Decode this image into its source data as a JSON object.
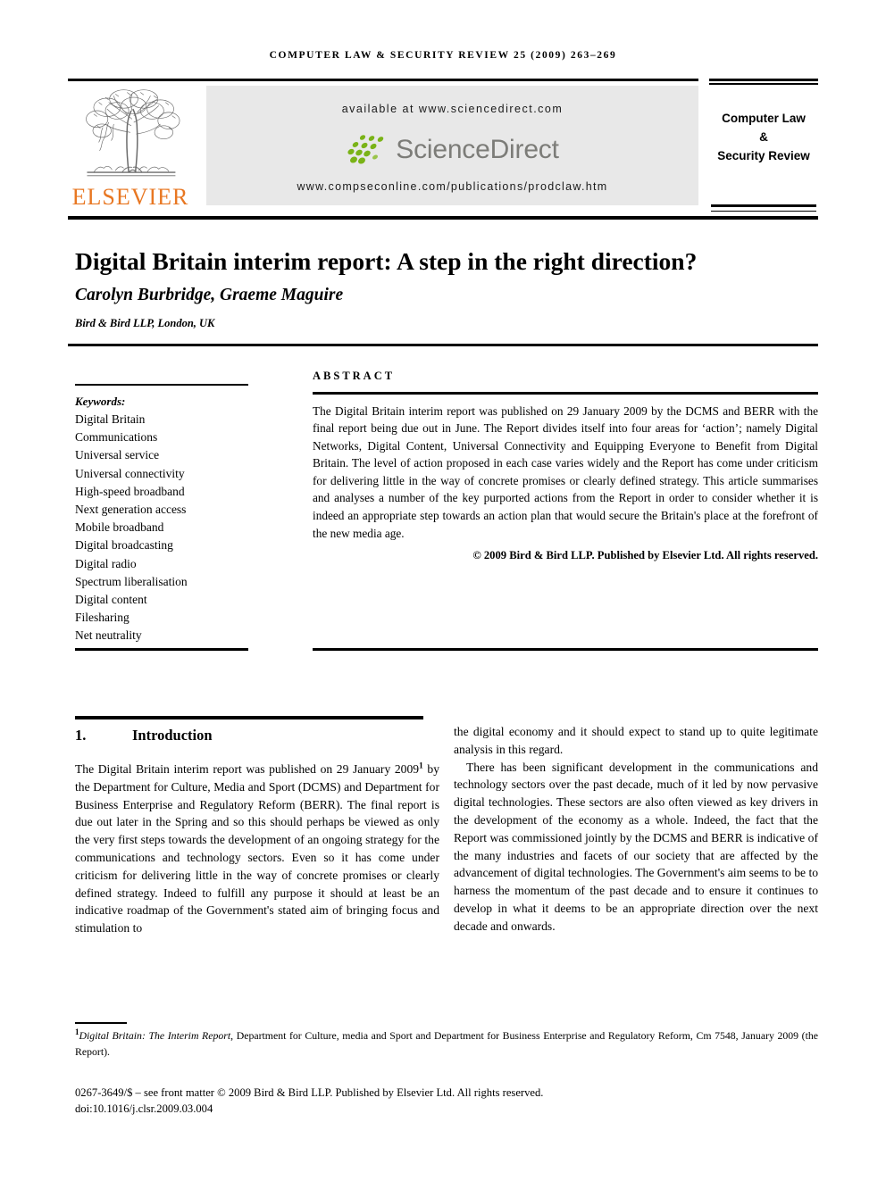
{
  "running_head": "COMPUTER LAW & SECURITY REVIEW 25 (2009) 263–269",
  "masthead": {
    "publisher_name": "ELSEVIER",
    "available_at": "available at www.sciencedirect.com",
    "sciencedirect_wordmark": "ScienceDirect",
    "journal_url": "www.compseconline.com/publications/prodclaw.htm",
    "journal_box_line1": "Computer Law",
    "journal_box_line2": "&",
    "journal_box_line3": "Security Review",
    "colors": {
      "elsevier_orange": "#E87722",
      "sciencedirect_green": "#7AB317",
      "sciencedirect_gray": "#7c7c78",
      "banner_background": "#e8e8e8"
    }
  },
  "article": {
    "title": "Digital Britain interim report: A step in the right direction?",
    "authors": "Carolyn Burbridge, Graeme Maguire",
    "affiliation": "Bird & Bird LLP, London, UK"
  },
  "keywords": {
    "label": "Keywords:",
    "items": [
      "Digital Britain",
      "Communications",
      "Universal service",
      "Universal connectivity",
      "High-speed broadband",
      "Next generation access",
      "Mobile broadband",
      "Digital broadcasting",
      "Digital radio",
      "Spectrum liberalisation",
      "Digital content",
      "Filesharing",
      "Net neutrality"
    ]
  },
  "abstract": {
    "heading": "ABSTRACT",
    "body": "The Digital Britain interim report was published on 29 January 2009 by the DCMS and BERR with the final report being due out in June. The Report divides itself into four areas for ‘action’; namely Digital Networks, Digital Content, Universal Connectivity and Equipping Everyone to Benefit from Digital Britain. The level of action proposed in each case varies widely and the Report has come under criticism for delivering little in the way of concrete promises or clearly defined strategy. This article summarises and analyses a number of the key purported actions from the Report in order to consider whether it is indeed an appropriate step towards an action plan that would secure the Britain's place at the forefront of the new media age.",
    "copyright": "© 2009 Bird & Bird LLP. Published by Elsevier Ltd. All rights reserved."
  },
  "section": {
    "number": "1.",
    "title": "Introduction",
    "left_paragraph_part1": "The Digital Britain interim report was published on 29 January 2009",
    "footnote_marker": "1",
    "left_paragraph_part2": " by the Department for Culture, Media and Sport (DCMS) and Department for Business Enterprise and Regulatory Reform (BERR). The final report is due out later in the Spring and so this should perhaps be viewed as only the very first steps towards the development of an ongoing strategy for the communications and technology sectors. Even so it has come under criticism for delivering little in the way of concrete promises or clearly defined strategy. Indeed to fulfill any purpose it should at least be an indicative roadmap of the Government's stated aim of bringing focus and stimulation to",
    "right_paragraph_1": "the digital economy and it should expect to stand up to quite legitimate analysis in this regard.",
    "right_paragraph_2": "There has been significant development in the communications and technology sectors over the past decade, much of it led by now pervasive digital technologies. These sectors are also often viewed as key drivers in the development of the economy as a whole. Indeed, the fact that the Report was commissioned jointly by the DCMS and BERR is indicative of the many industries and facets of our society that are affected by the advancement of digital technologies. The Government's aim seems to be to harness the momentum of the past decade and to ensure it continues to develop in what it deems to be an appropriate direction over the next decade and onwards."
  },
  "footnote": {
    "number": "1",
    "italic_title": "Digital Britain: The Interim Report",
    "rest": ", Department for Culture, media and Sport and Department for Business Enterprise and Regulatory Reform, Cm 7548, January 2009 (the Report)."
  },
  "footer": {
    "line1": "0267-3649/$ – see front matter © 2009 Bird & Bird LLP. Published by Elsevier Ltd. All rights reserved.",
    "line2": "doi:10.1016/j.clsr.2009.03.004"
  }
}
